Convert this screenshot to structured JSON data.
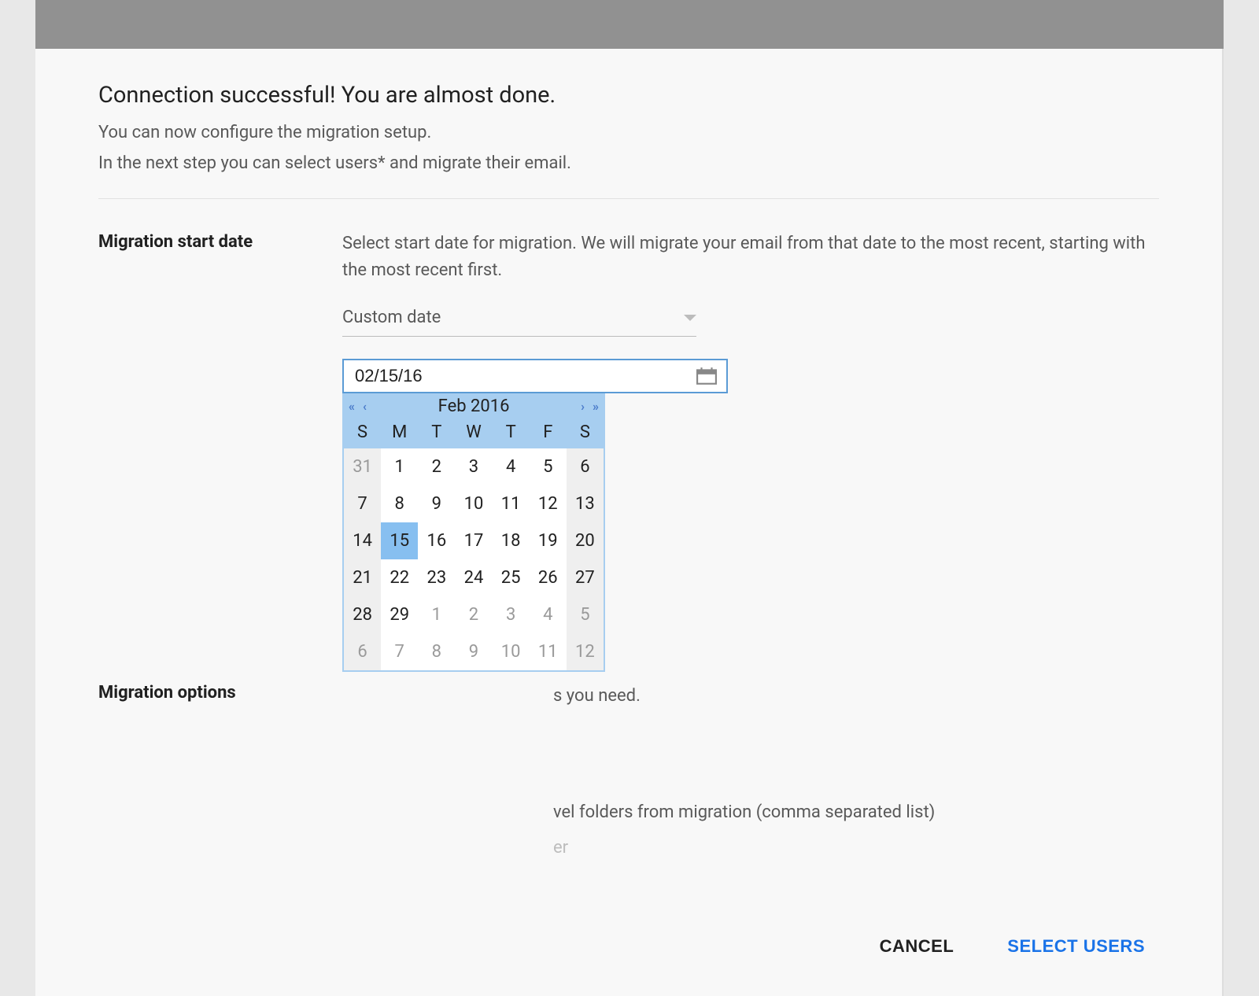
{
  "header": {
    "title": "Connection successful! You are almost done.",
    "subtitle1": "You can now configure the migration setup.",
    "subtitle2": "In the next step you can select users* and migrate their email."
  },
  "startDate": {
    "label": "Migration start date",
    "description": "Select start date for migration. We will migrate your email from that date to the most recent, starting with the most recent first.",
    "selectValue": "Custom date",
    "dateValue": "02/15/16"
  },
  "calendar": {
    "navPrevYear": "«",
    "navPrevMonth": "‹",
    "navNextMonth": "›",
    "navNextYear": "»",
    "title": "Feb 2016",
    "dow": [
      "S",
      "M",
      "T",
      "W",
      "T",
      "F",
      "S"
    ],
    "weeks": [
      [
        {
          "d": "31",
          "other": true,
          "weekend": true
        },
        {
          "d": "1"
        },
        {
          "d": "2"
        },
        {
          "d": "3"
        },
        {
          "d": "4"
        },
        {
          "d": "5"
        },
        {
          "d": "6",
          "weekend": true
        }
      ],
      [
        {
          "d": "7",
          "weekend": true
        },
        {
          "d": "8"
        },
        {
          "d": "9"
        },
        {
          "d": "10"
        },
        {
          "d": "11"
        },
        {
          "d": "12"
        },
        {
          "d": "13",
          "weekend": true
        }
      ],
      [
        {
          "d": "14",
          "weekend": true
        },
        {
          "d": "15",
          "selected": true
        },
        {
          "d": "16"
        },
        {
          "d": "17"
        },
        {
          "d": "18"
        },
        {
          "d": "19"
        },
        {
          "d": "20",
          "weekend": true
        }
      ],
      [
        {
          "d": "21",
          "weekend": true
        },
        {
          "d": "22"
        },
        {
          "d": "23"
        },
        {
          "d": "24"
        },
        {
          "d": "25"
        },
        {
          "d": "26"
        },
        {
          "d": "27",
          "weekend": true
        }
      ],
      [
        {
          "d": "28",
          "weekend": true
        },
        {
          "d": "29"
        },
        {
          "d": "1",
          "other": true
        },
        {
          "d": "2",
          "other": true
        },
        {
          "d": "3",
          "other": true
        },
        {
          "d": "4",
          "other": true
        },
        {
          "d": "5",
          "other": true,
          "weekend": true
        }
      ],
      [
        {
          "d": "6",
          "other": true,
          "weekend": true
        },
        {
          "d": "7",
          "other": true
        },
        {
          "d": "8",
          "other": true
        },
        {
          "d": "9",
          "other": true
        },
        {
          "d": "10",
          "other": true
        },
        {
          "d": "11",
          "other": true
        },
        {
          "d": "12",
          "other": true,
          "weekend": true
        }
      ]
    ]
  },
  "options": {
    "label": "Migration options",
    "line1suffix": "s you need.",
    "line2suffix": "vel folders from migration (comma separated list)",
    "line3suffix": "er"
  },
  "actions": {
    "cancel": "CANCEL",
    "primary": "SELECT USERS"
  }
}
